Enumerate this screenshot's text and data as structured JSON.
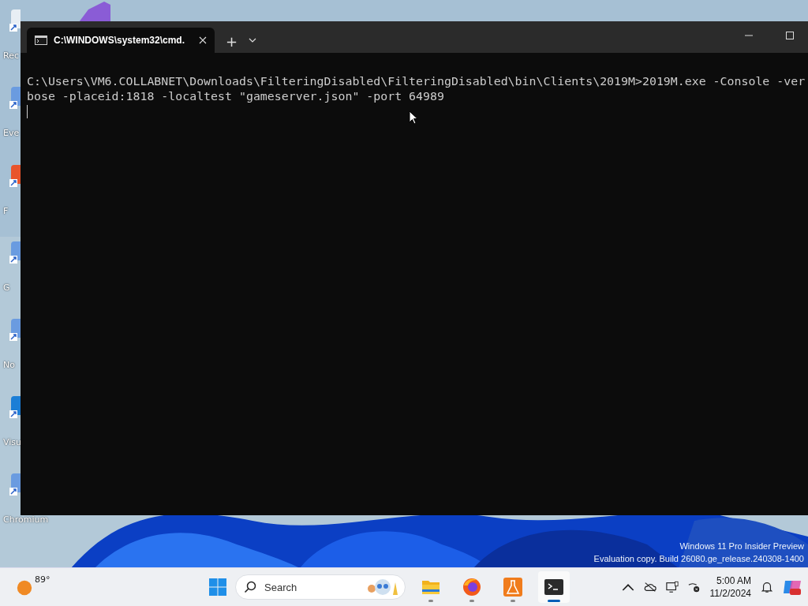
{
  "desktop_icons": [
    {
      "label": "Rec"
    },
    {
      "label": "Eve"
    },
    {
      "label": "F"
    },
    {
      "label": "G"
    },
    {
      "label": "No"
    },
    {
      "label": "Visu"
    },
    {
      "label": "Chromium"
    }
  ],
  "window": {
    "tab_title": "C:\\WINDOWS\\system32\\cmd.",
    "new_tab": "+",
    "console_lines": [
      "C:\\Users\\VM6.COLLABNET\\Downloads\\FilteringDisabled\\FilteringDisabled\\bin\\Clients\\2019M>2019M.exe -Console -ver",
      "bose -placeid:1818 -localtest \"gameserver.json\" -port 64989"
    ]
  },
  "watermark": [
    "Windows 11 Pro Insider Preview",
    "Evaluation copy. Build 26080.ge_release.240308-1400"
  ],
  "taskbar": {
    "weather": "89°",
    "search": {
      "placeholder": "Search"
    },
    "apps": [
      {
        "kind": "folder",
        "running": true,
        "active": false
      },
      {
        "kind": "browser",
        "running": true,
        "active": false
      },
      {
        "kind": "flask",
        "running": true,
        "active": false
      },
      {
        "kind": "terminal",
        "running": true,
        "active": true
      }
    ],
    "time": "5:00 AM",
    "date": "11/2/2024"
  }
}
